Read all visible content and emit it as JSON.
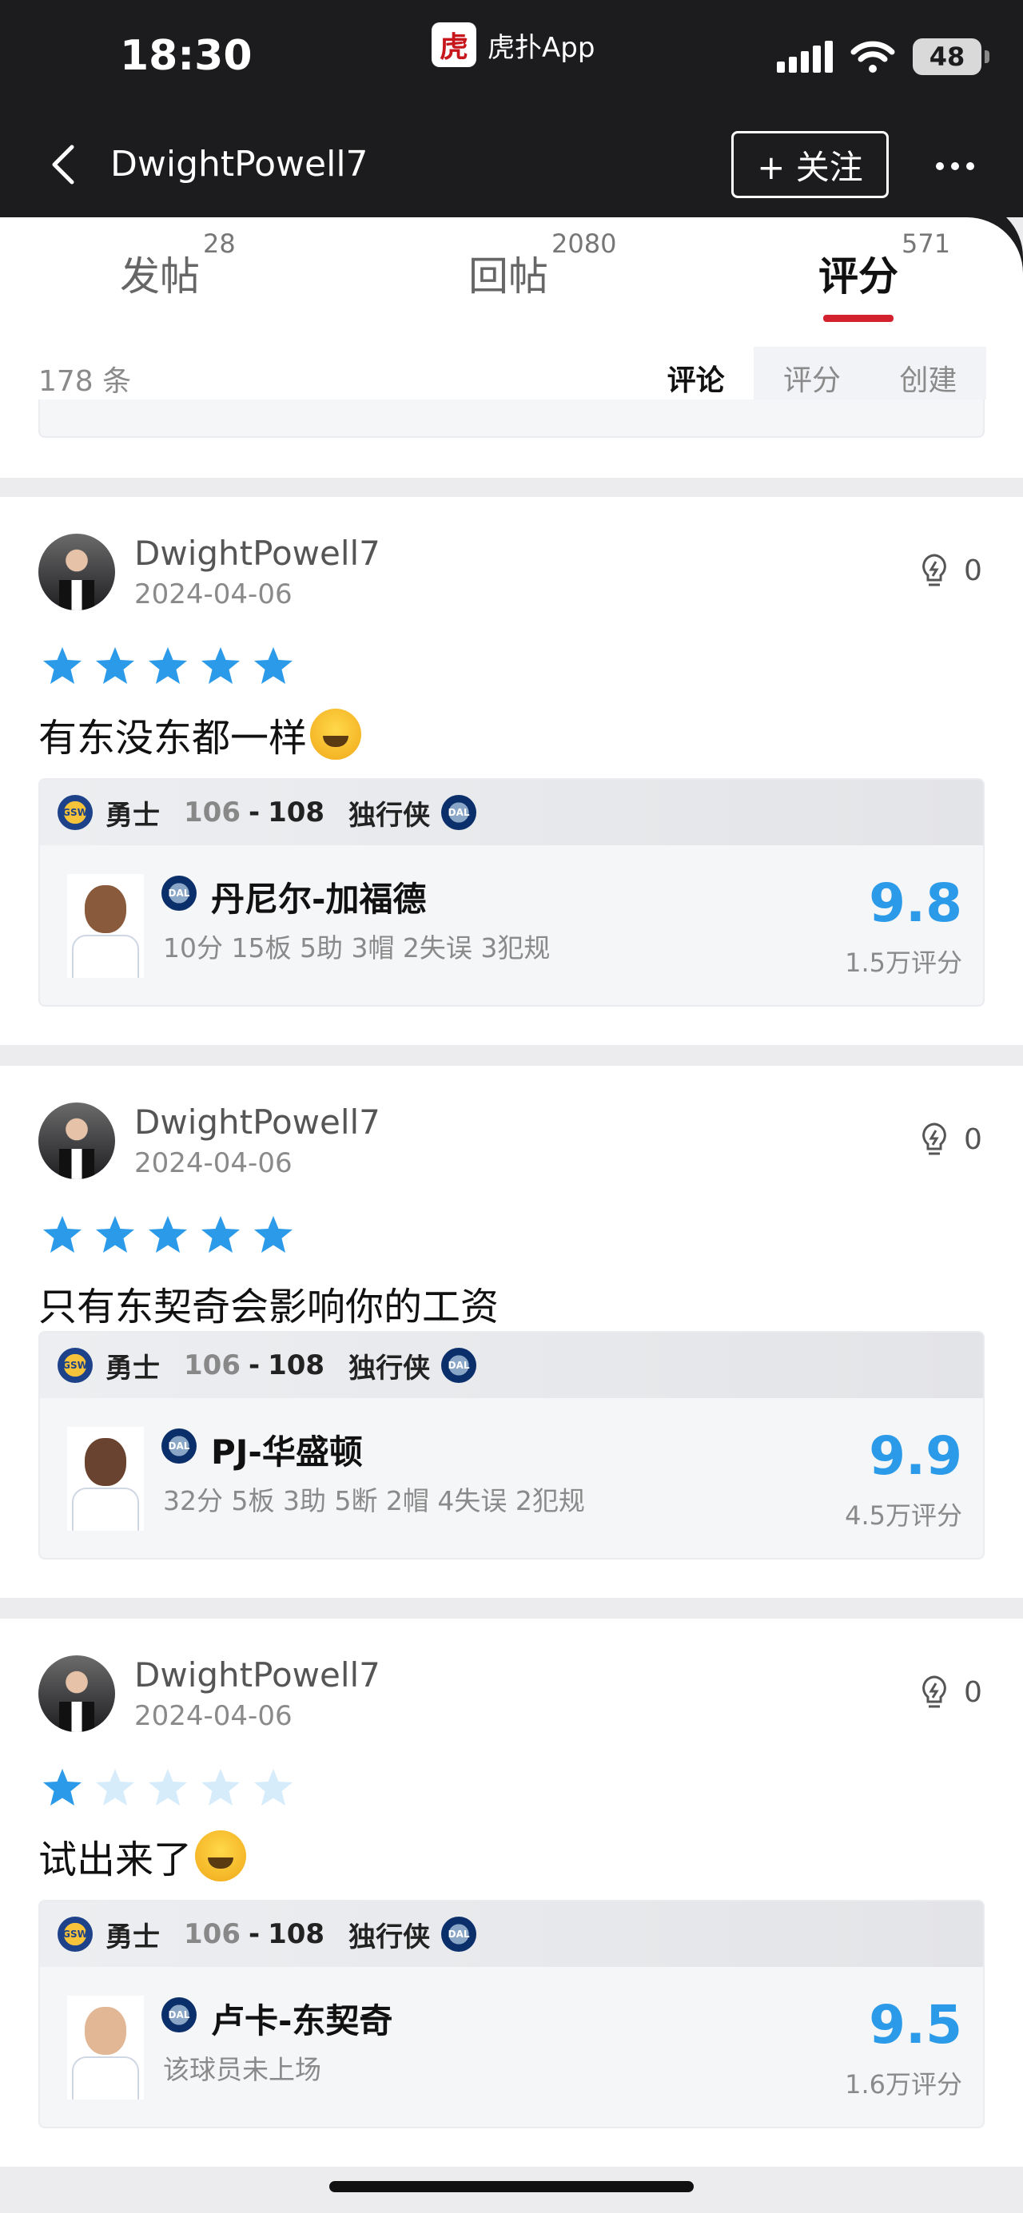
{
  "status": {
    "time": "18:30",
    "app_name": "虎扑App",
    "app_logo_glyph": "虎",
    "battery": "48"
  },
  "nav": {
    "title": "DwightPowell7",
    "follow_label": "+ 关注"
  },
  "tabs": [
    {
      "label": "发帖",
      "count": "28"
    },
    {
      "label": "回帖",
      "count": "2080"
    },
    {
      "label": "评分",
      "count": "571",
      "active": true
    }
  ],
  "filter": {
    "count_label": "178 条",
    "segments": [
      "评论",
      "评分",
      "创建"
    ],
    "selected": "评论"
  },
  "accent_color": "#2b9ae8",
  "posts": [
    {
      "user": "DwightPowell7",
      "date": "2024-04-06",
      "lights": "0",
      "rating": 5,
      "comment": "有东没东都一样",
      "emoji": "laughing-tears-emoji",
      "match": {
        "home": "勇士",
        "home_abbr": "GSW",
        "home_score": "106",
        "away_score": "108",
        "away": "独行侠",
        "away_abbr": "DAL"
      },
      "player": {
        "name": "丹尼尔-加福德",
        "stats": "10分 15板 5助 3帽 2失误 3犯规",
        "score": "9.8",
        "votes": "1.5万评分"
      }
    },
    {
      "user": "DwightPowell7",
      "date": "2024-04-06",
      "lights": "0",
      "rating": 5,
      "comment": "只有东契奇会影响你的工资",
      "match": {
        "home": "勇士",
        "home_abbr": "GSW",
        "home_score": "106",
        "away_score": "108",
        "away": "独行侠",
        "away_abbr": "DAL"
      },
      "player": {
        "name": "PJ-华盛顿",
        "stats": "32分 5板 3助 5断 2帽 4失误 2犯规",
        "score": "9.9",
        "votes": "4.5万评分"
      }
    },
    {
      "user": "DwightPowell7",
      "date": "2024-04-06",
      "lights": "0",
      "rating": 1,
      "comment": "试出来了",
      "emoji": "crying-emoji",
      "match": {
        "home": "勇士",
        "home_abbr": "GSW",
        "home_score": "106",
        "away_score": "108",
        "away": "独行侠",
        "away_abbr": "DAL"
      },
      "player": {
        "name": "卢卡-东契奇",
        "stats": "该球员未上场",
        "score": "9.5",
        "votes": "1.6万评分"
      }
    }
  ]
}
